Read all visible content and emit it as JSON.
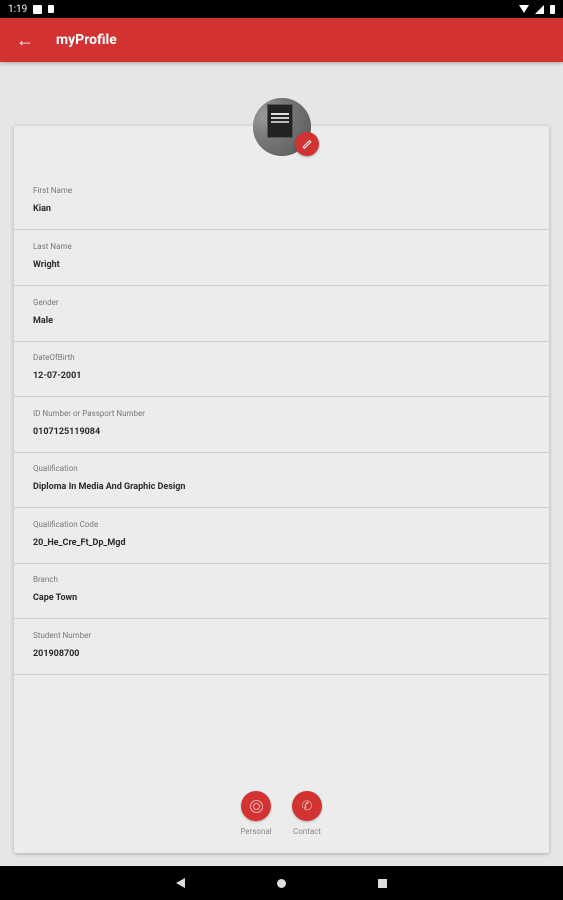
{
  "status_bar": {
    "time": "1:19"
  },
  "app_bar": {
    "title": "myProfile"
  },
  "fields": [
    {
      "label": "First Name",
      "value": "Kian"
    },
    {
      "label": "Last Name",
      "value": "Wright"
    },
    {
      "label": "Gender",
      "value": "Male"
    },
    {
      "label": "DateOfBirth",
      "value": "12-07-2001"
    },
    {
      "label": "ID Number or Passport Number",
      "value": "0107125119084"
    },
    {
      "label": "Qualification",
      "value": "Diploma In Media And Graphic Design"
    },
    {
      "label": "Qualification Code",
      "value": "20_He_Cre_Ft_Dp_Mgd"
    },
    {
      "label": "Branch",
      "value": "Cape Town"
    },
    {
      "label": "Student Number",
      "value": "201908700"
    }
  ],
  "bottom_nav": {
    "personal_label": "Personal",
    "contact_label": "Contact"
  },
  "colors": {
    "accent": "#d23232",
    "background": "#e6e6e6",
    "card": "#ececec"
  },
  "icons": {
    "back": "arrow-left-icon",
    "edit": "pencil-icon",
    "personal": "target-icon",
    "contact": "phone-icon"
  }
}
